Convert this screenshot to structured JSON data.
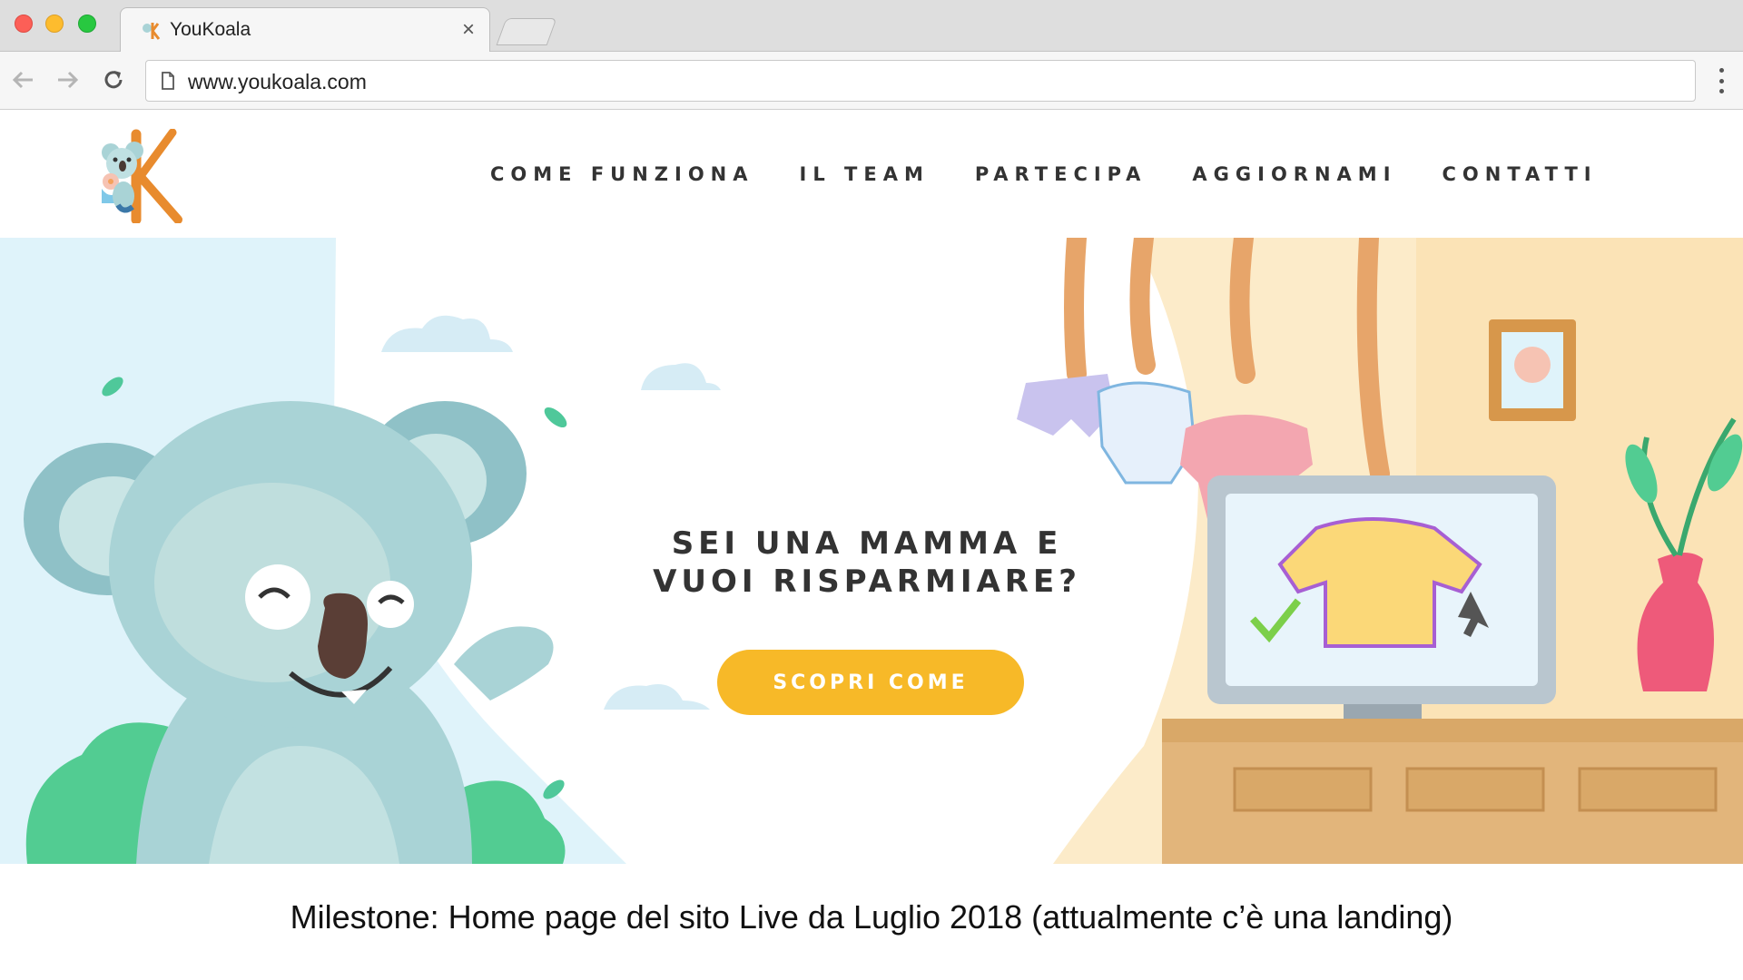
{
  "browser": {
    "tab_title": "YouKoala",
    "tab_close": "×",
    "url": "www.youkoala.com"
  },
  "site": {
    "nav": [
      "COME FUNZIONA",
      "IL TEAM",
      "PARTECIPA",
      "AGGIORNAMI",
      "CONTATTI"
    ]
  },
  "hero": {
    "headline_line1": "SEI UNA MAMMA E",
    "headline_line2": "VUOI RISPARMIARE?",
    "cta_label": "SCOPRI COME"
  },
  "caption": "Milestone: Home page del sito Live da Luglio 2018 (attualmente c’è una landing)",
  "colors": {
    "accent": "#f7b928",
    "koala": "#a9d3d6",
    "sky": "#dff3fa",
    "wall": "#fcebc9",
    "wood": "#e2b57b"
  },
  "icons": [
    "back-arrow-icon",
    "forward-arrow-icon",
    "reload-icon",
    "page-icon",
    "kebab-menu-icon",
    "close-icon"
  ]
}
